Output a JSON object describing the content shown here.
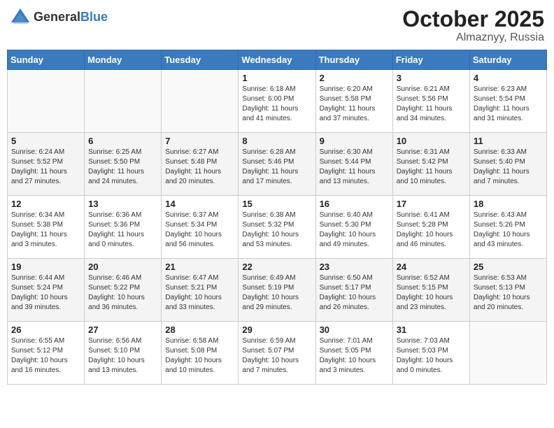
{
  "header": {
    "logo_general": "General",
    "logo_blue": "Blue",
    "month": "October 2025",
    "location": "Almaznyy, Russia"
  },
  "weekdays": [
    "Sunday",
    "Monday",
    "Tuesday",
    "Wednesday",
    "Thursday",
    "Friday",
    "Saturday"
  ],
  "weeks": [
    [
      {
        "day": "",
        "info": ""
      },
      {
        "day": "",
        "info": ""
      },
      {
        "day": "",
        "info": ""
      },
      {
        "day": "1",
        "info": "Sunrise: 6:18 AM\nSunset: 6:00 PM\nDaylight: 11 hours\nand 41 minutes."
      },
      {
        "day": "2",
        "info": "Sunrise: 6:20 AM\nSunset: 5:58 PM\nDaylight: 11 hours\nand 37 minutes."
      },
      {
        "day": "3",
        "info": "Sunrise: 6:21 AM\nSunset: 5:56 PM\nDaylight: 11 hours\nand 34 minutes."
      },
      {
        "day": "4",
        "info": "Sunrise: 6:23 AM\nSunset: 5:54 PM\nDaylight: 11 hours\nand 31 minutes."
      }
    ],
    [
      {
        "day": "5",
        "info": "Sunrise: 6:24 AM\nSunset: 5:52 PM\nDaylight: 11 hours\nand 27 minutes."
      },
      {
        "day": "6",
        "info": "Sunrise: 6:25 AM\nSunset: 5:50 PM\nDaylight: 11 hours\nand 24 minutes."
      },
      {
        "day": "7",
        "info": "Sunrise: 6:27 AM\nSunset: 5:48 PM\nDaylight: 11 hours\nand 20 minutes."
      },
      {
        "day": "8",
        "info": "Sunrise: 6:28 AM\nSunset: 5:46 PM\nDaylight: 11 hours\nand 17 minutes."
      },
      {
        "day": "9",
        "info": "Sunrise: 6:30 AM\nSunset: 5:44 PM\nDaylight: 11 hours\nand 13 minutes."
      },
      {
        "day": "10",
        "info": "Sunrise: 6:31 AM\nSunset: 5:42 PM\nDaylight: 11 hours\nand 10 minutes."
      },
      {
        "day": "11",
        "info": "Sunrise: 6:33 AM\nSunset: 5:40 PM\nDaylight: 11 hours\nand 7 minutes."
      }
    ],
    [
      {
        "day": "12",
        "info": "Sunrise: 6:34 AM\nSunset: 5:38 PM\nDaylight: 11 hours\nand 3 minutes."
      },
      {
        "day": "13",
        "info": "Sunrise: 6:36 AM\nSunset: 5:36 PM\nDaylight: 11 hours\nand 0 minutes."
      },
      {
        "day": "14",
        "info": "Sunrise: 6:37 AM\nSunset: 5:34 PM\nDaylight: 10 hours\nand 56 minutes."
      },
      {
        "day": "15",
        "info": "Sunrise: 6:38 AM\nSunset: 5:32 PM\nDaylight: 10 hours\nand 53 minutes."
      },
      {
        "day": "16",
        "info": "Sunrise: 6:40 AM\nSunset: 5:30 PM\nDaylight: 10 hours\nand 49 minutes."
      },
      {
        "day": "17",
        "info": "Sunrise: 6:41 AM\nSunset: 5:28 PM\nDaylight: 10 hours\nand 46 minutes."
      },
      {
        "day": "18",
        "info": "Sunrise: 6:43 AM\nSunset: 5:26 PM\nDaylight: 10 hours\nand 43 minutes."
      }
    ],
    [
      {
        "day": "19",
        "info": "Sunrise: 6:44 AM\nSunset: 5:24 PM\nDaylight: 10 hours\nand 39 minutes."
      },
      {
        "day": "20",
        "info": "Sunrise: 6:46 AM\nSunset: 5:22 PM\nDaylight: 10 hours\nand 36 minutes."
      },
      {
        "day": "21",
        "info": "Sunrise: 6:47 AM\nSunset: 5:21 PM\nDaylight: 10 hours\nand 33 minutes."
      },
      {
        "day": "22",
        "info": "Sunrise: 6:49 AM\nSunset: 5:19 PM\nDaylight: 10 hours\nand 29 minutes."
      },
      {
        "day": "23",
        "info": "Sunrise: 6:50 AM\nSunset: 5:17 PM\nDaylight: 10 hours\nand 26 minutes."
      },
      {
        "day": "24",
        "info": "Sunrise: 6:52 AM\nSunset: 5:15 PM\nDaylight: 10 hours\nand 23 minutes."
      },
      {
        "day": "25",
        "info": "Sunrise: 6:53 AM\nSunset: 5:13 PM\nDaylight: 10 hours\nand 20 minutes."
      }
    ],
    [
      {
        "day": "26",
        "info": "Sunrise: 6:55 AM\nSunset: 5:12 PM\nDaylight: 10 hours\nand 16 minutes."
      },
      {
        "day": "27",
        "info": "Sunrise: 6:56 AM\nSunset: 5:10 PM\nDaylight: 10 hours\nand 13 minutes."
      },
      {
        "day": "28",
        "info": "Sunrise: 6:58 AM\nSunset: 5:08 PM\nDaylight: 10 hours\nand 10 minutes."
      },
      {
        "day": "29",
        "info": "Sunrise: 6:59 AM\nSunset: 5:07 PM\nDaylight: 10 hours\nand 7 minutes."
      },
      {
        "day": "30",
        "info": "Sunrise: 7:01 AM\nSunset: 5:05 PM\nDaylight: 10 hours\nand 3 minutes."
      },
      {
        "day": "31",
        "info": "Sunrise: 7:03 AM\nSunset: 5:03 PM\nDaylight: 10 hours\nand 0 minutes."
      },
      {
        "day": "",
        "info": ""
      }
    ]
  ]
}
